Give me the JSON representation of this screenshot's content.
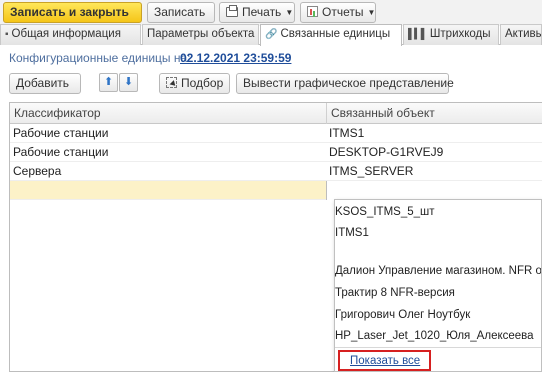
{
  "toolbar": {
    "save_close": "Записать и закрыть",
    "save": "Записать",
    "print": "Печать",
    "reports": "Отчеты"
  },
  "tabs": [
    {
      "label": "Общая информация"
    },
    {
      "label": "Параметры объекта"
    },
    {
      "label": "Связанные единицы"
    },
    {
      "label": "Штрихкоды"
    },
    {
      "label": "Активы"
    }
  ],
  "config": {
    "label": "Конфигурационные единицы на:",
    "value": "02.12.2021 23:59:59"
  },
  "commands": {
    "add": "Добавить",
    "up_icon": "arrow-up-icon",
    "down_icon": "arrow-down-icon",
    "select": "Подбор",
    "graph": "Вывести графическое представление"
  },
  "table": {
    "headers": [
      "Классификатор",
      "Связанный объект"
    ],
    "rows": [
      [
        "Рабочие станции",
        "ITMS1"
      ],
      [
        "Рабочие станции",
        "DESKTOP-G1RVEJ9"
      ],
      [
        "Сервера",
        "ITMS_SERVER"
      ]
    ]
  },
  "dropdown": {
    "items": [
      "KSOS_ITMS_5_шт",
      "ITMS1",
      "",
      "Далион Управление магазином. NFR ос",
      "Трактир 8 NFR-версия",
      "Григорович Олег Ноутбук",
      "HP_Laser_Jet_1020_Юля_Алексеева"
    ],
    "show_all": "Показать все"
  },
  "colors": {
    "accent_primary": "#f5c518",
    "link": "#1f4d9a",
    "edit_row": "#fcf2c8",
    "highlight_box": "#d62020"
  }
}
